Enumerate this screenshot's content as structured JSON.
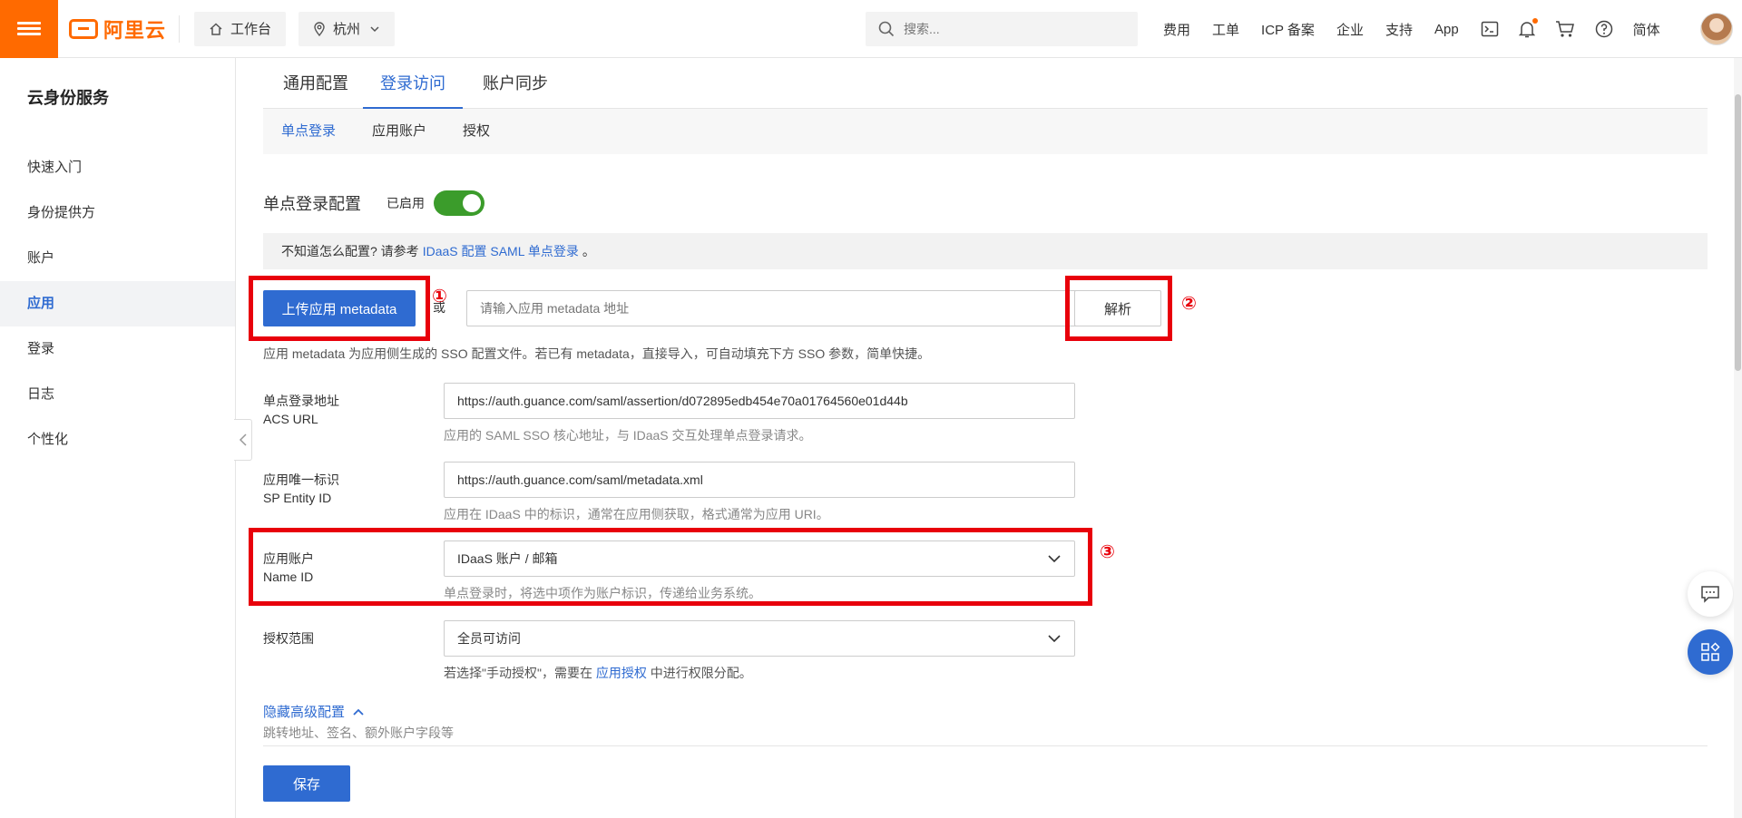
{
  "topbar": {
    "logo_text": "阿里云",
    "workbench": "工作台",
    "region": "杭州",
    "search_placeholder": "搜索...",
    "links": [
      "费用",
      "工单",
      "ICP 备案",
      "企业",
      "支持",
      "App"
    ],
    "lang": "简体"
  },
  "sidebar": {
    "title": "云身份服务",
    "items": [
      "快速入门",
      "身份提供方",
      "账户",
      "应用",
      "登录",
      "日志",
      "个性化"
    ],
    "active_index": 3
  },
  "tabs": [
    "通用配置",
    "登录访问",
    "账户同步"
  ],
  "subtabs": [
    "单点登录",
    "应用账户",
    "授权"
  ],
  "sso": {
    "title": "单点登录配置",
    "status": "已启用",
    "tip_prefix": "不知道怎么配置? 请参考",
    "tip_link": "IDaaS 配置 SAML 单点登录",
    "tip_suffix": "。",
    "upload_button": "上传应用 metadata",
    "or": "或",
    "metadata_placeholder": "请输入应用 metadata 地址",
    "parse_button": "解析",
    "metadata_help": "应用 metadata 为应用侧生成的 SSO 配置文件。若已有 metadata，直接导入，可自动填充下方 SSO 参数，简单快捷。"
  },
  "fields": {
    "acs": {
      "label_cn": "单点登录地址",
      "label_en": "ACS URL",
      "value": "https://auth.guance.com/saml/assertion/d072895edb454e70a01764560e01d44b",
      "help": "应用的 SAML SSO 核心地址，与 IDaaS 交互处理单点登录请求。"
    },
    "entity": {
      "label_cn": "应用唯一标识",
      "label_en": "SP Entity ID",
      "value": "https://auth.guance.com/saml/metadata.xml",
      "help": "应用在 IDaaS 中的标识，通常在应用侧获取，格式通常为应用 URI。"
    },
    "nameid": {
      "label_cn": "应用账户",
      "label_en": "Name ID",
      "value": "IDaaS 账户 / 邮箱",
      "help": "单点登录时，将选中项作为账户标识，传递给业务系统。"
    },
    "scope": {
      "label_cn": "授权范围",
      "value": "全员可访问",
      "help_prefix": "若选择\"手动授权\"，需要在",
      "help_link": "应用授权",
      "help_suffix": "中进行权限分配。"
    }
  },
  "advanced": {
    "link": "隐藏高级配置",
    "help": "跳转地址、签名、额外账户字段等"
  },
  "save_button": "保存",
  "annotations": [
    "①",
    "②",
    "③"
  ],
  "colors": {
    "brand_orange": "#ff6a00",
    "primary_blue": "#2f6bd1",
    "toggle_green": "#3b9c2b",
    "annotation_red": "#e8000b"
  }
}
